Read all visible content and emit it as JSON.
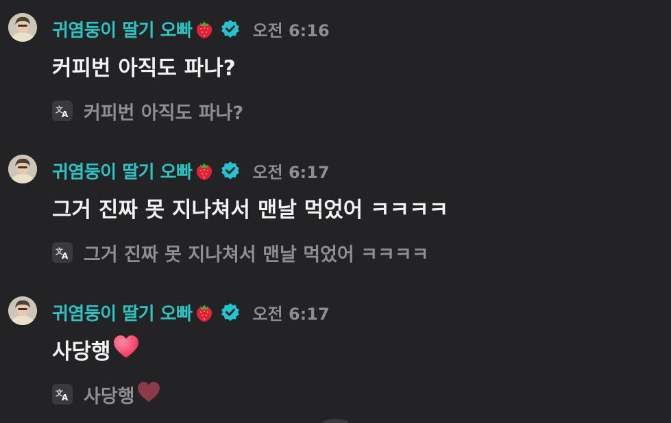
{
  "messages": [
    {
      "author": "귀염둥이 딸기 오빠",
      "author_emoji": "strawberry-icon",
      "verified": true,
      "time": "오전 6:16",
      "text": "커피번 아직도 파나?",
      "translation": "커피번 아직도 파나?",
      "trailing_emoji": null
    },
    {
      "author": "귀염둥이 딸기 오빠",
      "author_emoji": "strawberry-icon",
      "verified": true,
      "time": "오전 6:17",
      "text": "그거 진짜 못 지나쳐서 맨날 먹었어 ㅋㅋㅋㅋ",
      "translation": "그거 진짜 못 지나쳐서 맨날 먹었어 ㅋㅋㅋㅋ",
      "trailing_emoji": null
    },
    {
      "author": "귀염둥이 딸기 오빠",
      "author_emoji": "strawberry-icon",
      "verified": true,
      "time": "오전 6:17",
      "text": "사당행",
      "translation": "사당행",
      "trailing_emoji": "heart-icon"
    }
  ],
  "colors": {
    "background": "#232325",
    "author": "#2ec4c4",
    "verified_badge": "#27c2cf",
    "message_text": "#f2f2f2",
    "meta_text": "#8e8e90",
    "heart": "#ff3d6e",
    "heart_muted": "#8a3a4a"
  }
}
